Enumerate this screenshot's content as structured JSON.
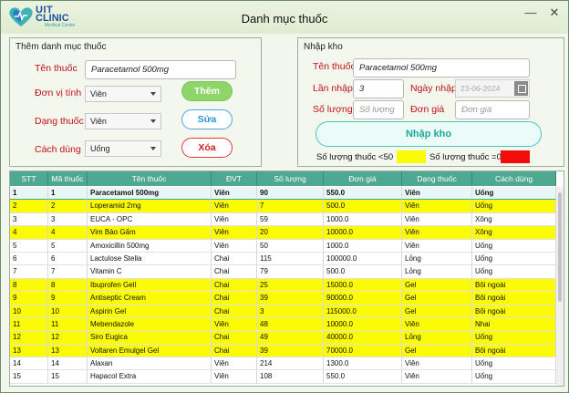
{
  "window": {
    "title": "Danh mục thuốc",
    "logo_line1": "UIT",
    "logo_line2": "CLINIC",
    "logo_line3": "Medical Center",
    "minimize_glyph": "—",
    "close_glyph": "✕"
  },
  "add_panel": {
    "title": "Thêm danh mục thuốc",
    "ten_thuoc_label": "Tên thuốc",
    "ten_thuoc_value": "Paracetamol 500mg",
    "don_vi_label": "Đơn vị tính",
    "don_vi_value": "Viên",
    "dang_thuoc_label": "Dạng thuốc",
    "dang_thuoc_value": "Viên",
    "cach_dung_label": "Cách dùng",
    "cach_dung_value": "Uống",
    "btn_them": "Thêm",
    "btn_sua": "Sửa",
    "btn_xoa": "Xóa"
  },
  "import_panel": {
    "title": "Nhập kho",
    "ten_thuoc_label": "Tên thuốc",
    "ten_thuoc_value": "Paracetamol 500mg",
    "lan_nhap_label": "Lần nhập",
    "lan_nhap_value": "3",
    "ngay_nhap_label": "Ngày nhập",
    "ngay_nhap_value": "23-06-2024",
    "so_luong_label": "Số lượng",
    "so_luong_placeholder": "Số lượng",
    "don_gia_label": "Đơn giá",
    "don_gia_placeholder": "Đơn giá",
    "btn_nhap_kho": "Nhập kho",
    "legend_low": "Số lượng thuốc <50",
    "legend_low_color": "#fbfb05",
    "legend_zero": "Số lượng thuốc =0",
    "legend_zero_color": "#f20d0d"
  },
  "table": {
    "columns": [
      "STT",
      "Mã thuốc",
      "Tên thuốc",
      "ĐVT",
      "Số lượng",
      "Đơn giá",
      "Dạng thuốc",
      "Cách dùng"
    ],
    "rows": [
      {
        "stt": "1",
        "ma": "1",
        "ten": "Paracetamol 500mg",
        "dvt": "Viên",
        "sl": "90",
        "gia": "550.0",
        "dang": "Viên",
        "cach": "Uống",
        "style": "selected"
      },
      {
        "stt": "2",
        "ma": "2",
        "ten": "Loperamid 2mg",
        "dvt": "Viên",
        "sl": "7",
        "gia": "500.0",
        "dang": "Viên",
        "cach": "Uống",
        "style": "yellow"
      },
      {
        "stt": "3",
        "ma": "3",
        "ten": "EUCA - OPC",
        "dvt": "Viên",
        "sl": "59",
        "gia": "1000.0",
        "dang": "Viên",
        "cach": "Xông",
        "style": "white"
      },
      {
        "stt": "4",
        "ma": "4",
        "ten": "Vim Bảo Gấm",
        "dvt": "Viên",
        "sl": "20",
        "gia": "10000.0",
        "dang": "Viên",
        "cach": "Xông",
        "style": "yellow"
      },
      {
        "stt": "5",
        "ma": "5",
        "ten": "Amoxicillin 500mg",
        "dvt": "Viên",
        "sl": "50",
        "gia": "1000.0",
        "dang": "Viên",
        "cach": "Uống",
        "style": "white"
      },
      {
        "stt": "6",
        "ma": "6",
        "ten": "Lactulose Stella",
        "dvt": "Chai",
        "sl": "115",
        "gia": "100000.0",
        "dang": "Lỏng",
        "cach": "Uống",
        "style": "white"
      },
      {
        "stt": "7",
        "ma": "7",
        "ten": "Vitamin C",
        "dvt": "Chai",
        "sl": "79",
        "gia": "500.0",
        "dang": "Lỏng",
        "cach": "Uống",
        "style": "white"
      },
      {
        "stt": "8",
        "ma": "8",
        "ten": "Ibuprofen Gell",
        "dvt": "Chai",
        "sl": "25",
        "gia": "15000.0",
        "dang": "Gel",
        "cach": "Bôi ngoài",
        "style": "yellow"
      },
      {
        "stt": "9",
        "ma": "9",
        "ten": "Antiseptic Cream",
        "dvt": "Chai",
        "sl": "39",
        "gia": "90000.0",
        "dang": "Gel",
        "cach": "Bôi ngoài",
        "style": "yellow"
      },
      {
        "stt": "10",
        "ma": "10",
        "ten": "Aspirin Gel",
        "dvt": "Chai",
        "sl": "3",
        "gia": "115000.0",
        "dang": "Gel",
        "cach": "Bôi ngoài",
        "style": "yellow"
      },
      {
        "stt": "11",
        "ma": "11",
        "ten": "Mebendazole",
        "dvt": "Viên",
        "sl": "48",
        "gia": "10000.0",
        "dang": "Viên",
        "cach": "Nhai",
        "style": "yellow"
      },
      {
        "stt": "12",
        "ma": "12",
        "ten": "Siro Eugica",
        "dvt": "Chai",
        "sl": "49",
        "gia": "40000.0",
        "dang": "Lỏng",
        "cach": "Uống",
        "style": "yellow"
      },
      {
        "stt": "13",
        "ma": "13",
        "ten": "Voltaren Emulgel Gel",
        "dvt": "Chai",
        "sl": "39",
        "gia": "70000.0",
        "dang": "Gel",
        "cach": "Bôi ngoài",
        "style": "yellow"
      },
      {
        "stt": "14",
        "ma": "14",
        "ten": "Alaxan",
        "dvt": "Viên",
        "sl": "214",
        "gia": "1300.0",
        "dang": "Viên",
        "cach": "Uống",
        "style": "white"
      },
      {
        "stt": "15",
        "ma": "15",
        "ten": "Hapacol Extra",
        "dvt": "Viên",
        "sl": "108",
        "gia": "550.0",
        "dang": "Viên",
        "cach": "Uống",
        "style": "white"
      }
    ]
  }
}
